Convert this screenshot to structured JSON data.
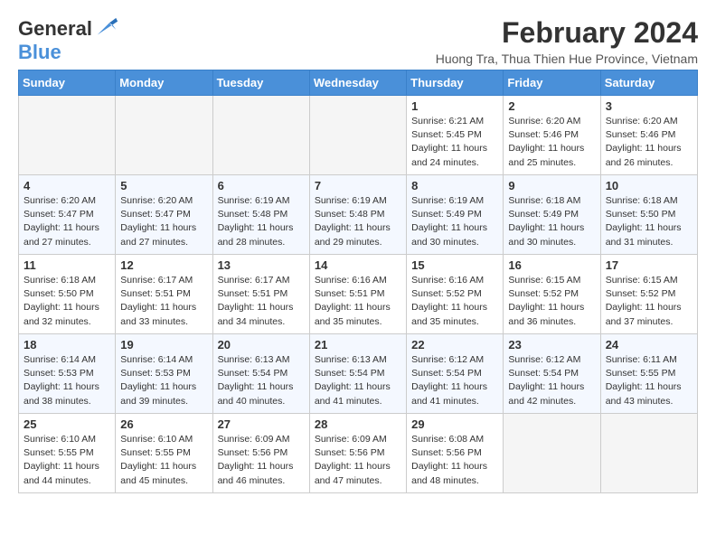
{
  "header": {
    "logo_line1": "General",
    "logo_line2": "Blue",
    "title": "February 2024",
    "subtitle": "Huong Tra, Thua Thien Hue Province, Vietnam"
  },
  "weekdays": [
    "Sunday",
    "Monday",
    "Tuesday",
    "Wednesday",
    "Thursday",
    "Friday",
    "Saturday"
  ],
  "weeks": [
    [
      {
        "day": "",
        "info": "",
        "empty": true
      },
      {
        "day": "",
        "info": "",
        "empty": true
      },
      {
        "day": "",
        "info": "",
        "empty": true
      },
      {
        "day": "",
        "info": "",
        "empty": true
      },
      {
        "day": "1",
        "info": "Sunrise: 6:21 AM\nSunset: 5:45 PM\nDaylight: 11 hours and 24 minutes.",
        "empty": false
      },
      {
        "day": "2",
        "info": "Sunrise: 6:20 AM\nSunset: 5:46 PM\nDaylight: 11 hours and 25 minutes.",
        "empty": false
      },
      {
        "day": "3",
        "info": "Sunrise: 6:20 AM\nSunset: 5:46 PM\nDaylight: 11 hours and 26 minutes.",
        "empty": false
      }
    ],
    [
      {
        "day": "4",
        "info": "Sunrise: 6:20 AM\nSunset: 5:47 PM\nDaylight: 11 hours and 27 minutes.",
        "empty": false
      },
      {
        "day": "5",
        "info": "Sunrise: 6:20 AM\nSunset: 5:47 PM\nDaylight: 11 hours and 27 minutes.",
        "empty": false
      },
      {
        "day": "6",
        "info": "Sunrise: 6:19 AM\nSunset: 5:48 PM\nDaylight: 11 hours and 28 minutes.",
        "empty": false
      },
      {
        "day": "7",
        "info": "Sunrise: 6:19 AM\nSunset: 5:48 PM\nDaylight: 11 hours and 29 minutes.",
        "empty": false
      },
      {
        "day": "8",
        "info": "Sunrise: 6:19 AM\nSunset: 5:49 PM\nDaylight: 11 hours and 30 minutes.",
        "empty": false
      },
      {
        "day": "9",
        "info": "Sunrise: 6:18 AM\nSunset: 5:49 PM\nDaylight: 11 hours and 30 minutes.",
        "empty": false
      },
      {
        "day": "10",
        "info": "Sunrise: 6:18 AM\nSunset: 5:50 PM\nDaylight: 11 hours and 31 minutes.",
        "empty": false
      }
    ],
    [
      {
        "day": "11",
        "info": "Sunrise: 6:18 AM\nSunset: 5:50 PM\nDaylight: 11 hours and 32 minutes.",
        "empty": false
      },
      {
        "day": "12",
        "info": "Sunrise: 6:17 AM\nSunset: 5:51 PM\nDaylight: 11 hours and 33 minutes.",
        "empty": false
      },
      {
        "day": "13",
        "info": "Sunrise: 6:17 AM\nSunset: 5:51 PM\nDaylight: 11 hours and 34 minutes.",
        "empty": false
      },
      {
        "day": "14",
        "info": "Sunrise: 6:16 AM\nSunset: 5:51 PM\nDaylight: 11 hours and 35 minutes.",
        "empty": false
      },
      {
        "day": "15",
        "info": "Sunrise: 6:16 AM\nSunset: 5:52 PM\nDaylight: 11 hours and 35 minutes.",
        "empty": false
      },
      {
        "day": "16",
        "info": "Sunrise: 6:15 AM\nSunset: 5:52 PM\nDaylight: 11 hours and 36 minutes.",
        "empty": false
      },
      {
        "day": "17",
        "info": "Sunrise: 6:15 AM\nSunset: 5:52 PM\nDaylight: 11 hours and 37 minutes.",
        "empty": false
      }
    ],
    [
      {
        "day": "18",
        "info": "Sunrise: 6:14 AM\nSunset: 5:53 PM\nDaylight: 11 hours and 38 minutes.",
        "empty": false
      },
      {
        "day": "19",
        "info": "Sunrise: 6:14 AM\nSunset: 5:53 PM\nDaylight: 11 hours and 39 minutes.",
        "empty": false
      },
      {
        "day": "20",
        "info": "Sunrise: 6:13 AM\nSunset: 5:54 PM\nDaylight: 11 hours and 40 minutes.",
        "empty": false
      },
      {
        "day": "21",
        "info": "Sunrise: 6:13 AM\nSunset: 5:54 PM\nDaylight: 11 hours and 41 minutes.",
        "empty": false
      },
      {
        "day": "22",
        "info": "Sunrise: 6:12 AM\nSunset: 5:54 PM\nDaylight: 11 hours and 41 minutes.",
        "empty": false
      },
      {
        "day": "23",
        "info": "Sunrise: 6:12 AM\nSunset: 5:54 PM\nDaylight: 11 hours and 42 minutes.",
        "empty": false
      },
      {
        "day": "24",
        "info": "Sunrise: 6:11 AM\nSunset: 5:55 PM\nDaylight: 11 hours and 43 minutes.",
        "empty": false
      }
    ],
    [
      {
        "day": "25",
        "info": "Sunrise: 6:10 AM\nSunset: 5:55 PM\nDaylight: 11 hours and 44 minutes.",
        "empty": false
      },
      {
        "day": "26",
        "info": "Sunrise: 6:10 AM\nSunset: 5:55 PM\nDaylight: 11 hours and 45 minutes.",
        "empty": false
      },
      {
        "day": "27",
        "info": "Sunrise: 6:09 AM\nSunset: 5:56 PM\nDaylight: 11 hours and 46 minutes.",
        "empty": false
      },
      {
        "day": "28",
        "info": "Sunrise: 6:09 AM\nSunset: 5:56 PM\nDaylight: 11 hours and 47 minutes.",
        "empty": false
      },
      {
        "day": "29",
        "info": "Sunrise: 6:08 AM\nSunset: 5:56 PM\nDaylight: 11 hours and 48 minutes.",
        "empty": false
      },
      {
        "day": "",
        "info": "",
        "empty": true
      },
      {
        "day": "",
        "info": "",
        "empty": true
      }
    ]
  ]
}
